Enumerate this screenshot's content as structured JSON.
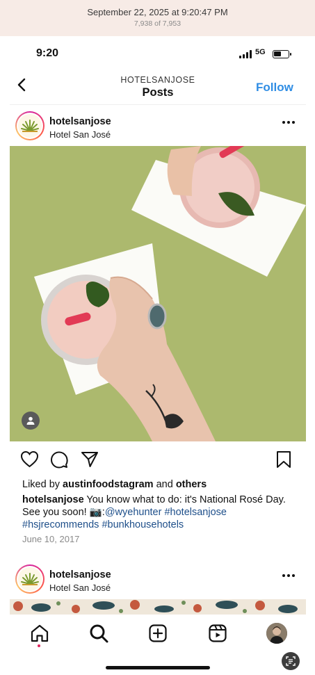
{
  "viewer": {
    "date": "September 22, 2025 at 9:20:47 PM",
    "count": "7,938 of 7,953"
  },
  "status_bar": {
    "time": "9:20",
    "network": "5G"
  },
  "header": {
    "username": "HOTELSANJOSE",
    "title": "Posts",
    "follow_label": "Follow"
  },
  "post": {
    "account": "hotelsanjose",
    "location": "Hotel San José",
    "liked_prefix": "Liked by",
    "liked_user": "austinfoodstagram",
    "liked_and": "and",
    "liked_others": "others",
    "caption_user": "hotelsanjose",
    "caption_text": " You know what to do: it's National Rosé Day. See you soon! 📷:",
    "mention": "@wyehunter",
    "hashtags": [
      "#hotelsanjose",
      "#hsjrecommends",
      "#bunkhousehotels"
    ],
    "date": "June 10, 2017"
  },
  "next_post": {
    "account": "hotelsanjose",
    "location": "Hotel San José"
  },
  "tab_bar": {
    "items": [
      "home-icon",
      "search-icon",
      "create-icon",
      "reels-icon",
      "profile-avatar"
    ]
  },
  "colors": {
    "follow": "#2f8de4",
    "hashtag": "#1e4f8a",
    "photo_background": "#a9b66b",
    "notification_dot": "#e0245e"
  }
}
